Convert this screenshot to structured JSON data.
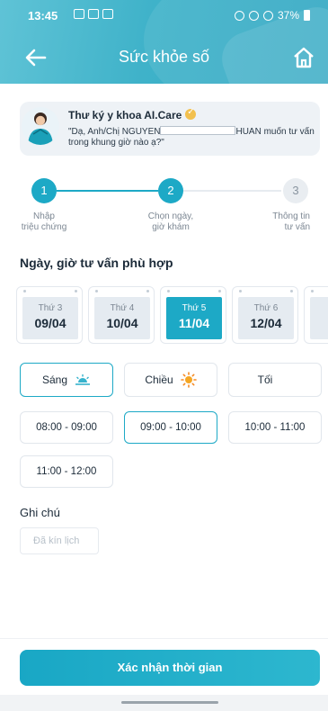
{
  "status_bar": {
    "time": "13:45",
    "battery": "37%"
  },
  "header": {
    "title": "Sức khỏe số",
    "back_icon": "arrow-left-icon",
    "home_icon": "home-icon"
  },
  "assistant": {
    "name": "Thư ký y khoa AI.Care",
    "message_prefix": "\"Dạ, Anh/Chị NGUYEN",
    "message_suffix": "HUAN muốn tư vấn trong khung giờ nào ạ?\""
  },
  "stepper": {
    "steps": [
      {
        "number": "1",
        "label_line1": "Nhập",
        "label_line2": "triệu chứng",
        "state": "done"
      },
      {
        "number": "2",
        "label_line1": "Chọn ngày,",
        "label_line2": "giờ khám",
        "state": "active"
      },
      {
        "number": "3",
        "label_line1": "Thông tin",
        "label_line2": "tư vấn",
        "state": "pending"
      }
    ]
  },
  "date_section": {
    "title": "Ngày, giờ tư vấn phù hợp",
    "days": [
      {
        "dow": "Thứ 3",
        "date": "09/04"
      },
      {
        "dow": "Thứ 4",
        "date": "10/04"
      },
      {
        "dow": "Thứ 5",
        "date": "11/04"
      },
      {
        "dow": "Thứ 6",
        "date": "12/04"
      },
      {
        "dow": "",
        "date": ""
      }
    ],
    "selected_day": "11/04"
  },
  "periods": [
    {
      "label": "Sáng",
      "icon": "sunrise-icon"
    },
    {
      "label": "Chiều",
      "icon": "sun-icon"
    },
    {
      "label": "Tối",
      "icon": "moon-icon"
    }
  ],
  "selected_period": "Sáng",
  "time_slots": [
    "08:00 - 09:00",
    "09:00 - 10:00",
    "10:00 - 11:00",
    "11:00 - 12:00"
  ],
  "selected_slot": "09:00 - 10:00",
  "note": {
    "label": "Ghi chú",
    "placeholder": "Đã kín lịch"
  },
  "confirm_button": "Xác nhận thời gian",
  "colors": {
    "accent": "#1da9c6",
    "header": "#3fb2c9",
    "pending": "#e9edf1"
  }
}
